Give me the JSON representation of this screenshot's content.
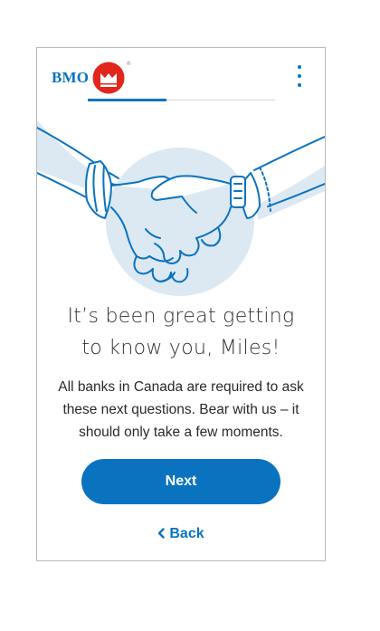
{
  "header": {
    "logo_text": "BMO",
    "logo_mark": "bmo-roundel-icon",
    "registered_mark": "®",
    "menu_icon": "more-vertical-icon",
    "progress_fraction": 0.42
  },
  "illustration": {
    "icon": "handshake-illustration"
  },
  "main": {
    "headline_line1": "It’s been great getting",
    "headline_line2": "to know you, Miles!",
    "body_line1": "All banks in Canada are required to ask",
    "body_line2": "these next questions. Bear with us – it",
    "body_line3": "should only take a few moments."
  },
  "actions": {
    "next_label": "Next",
    "back_label": "Back",
    "back_icon": "chevron-left-icon"
  },
  "colors": {
    "accent": "#0a73c0",
    "logo_red": "#e1261c",
    "illustration_fill": "#dce9f2"
  }
}
